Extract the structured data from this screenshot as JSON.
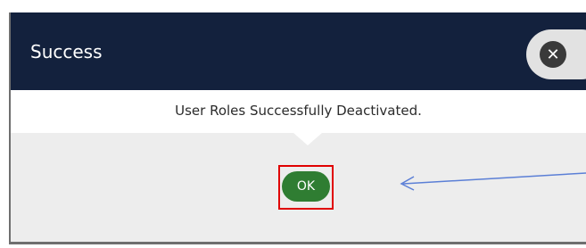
{
  "dialog": {
    "title": "Success",
    "close_icon": "close-icon",
    "close_glyph": "✕",
    "message": "User Roles Successfully Deactivated.",
    "ok_label": "OK"
  },
  "annotation": {
    "highlight_color": "#e00000",
    "arrow_color": "#5b7fd6"
  },
  "colors": {
    "header_bg": "#13213d",
    "ok_button": "#2f7d32",
    "body_bg": "#ededed"
  }
}
